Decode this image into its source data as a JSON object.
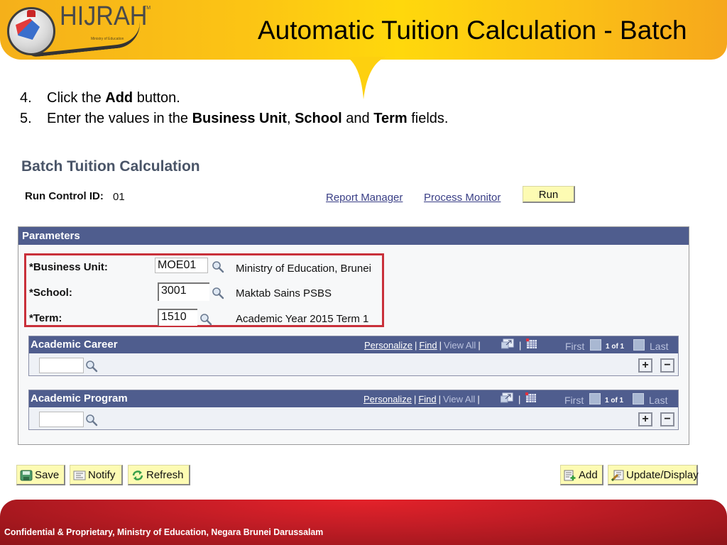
{
  "slide": {
    "logo_text": "HIJRAH",
    "logo_tm": "TM",
    "logo_subtitle": "Ministry of Education",
    "title": "Automatic Tuition Calculation - Batch",
    "footer": "Confidential & Proprietary, Ministry of Education, Negara Brunei Darussalam"
  },
  "instructions": [
    {
      "num": "4.",
      "pre": "Click the ",
      "b1": "Add",
      "mid1": " button.",
      "b2": "",
      "mid2": "",
      "b3": "",
      "post": ""
    },
    {
      "num": "5.",
      "pre": "Enter the values in the ",
      "b1": "Business Unit",
      "mid1": ", ",
      "b2": "School",
      "mid2": " and ",
      "b3": "Term",
      "post": " fields."
    }
  ],
  "page": {
    "title": "Batch Tuition Calculation",
    "run_control_label": "Run Control ID:",
    "run_control_value": "01",
    "report_manager": "Report Manager",
    "process_monitor": "Process Monitor",
    "run_button": "Run"
  },
  "parameters": {
    "header": "Parameters",
    "fields": [
      {
        "label": "*Business Unit:",
        "value": "MOE01",
        "description": "Ministry of Education, Brunei"
      },
      {
        "label": "*School:",
        "value": "3001",
        "description": "Maktab Sains PSBS"
      },
      {
        "label": "*Term:",
        "value": "1510",
        "description": "Academic Year 2015 Term 1"
      }
    ]
  },
  "grids": [
    {
      "title": "Academic Career",
      "personalize": "Personalize",
      "find": "Find",
      "view_all": "View All",
      "first": "First",
      "count": "1 of 1",
      "last": "Last",
      "value": "",
      "add": "+",
      "remove": "−"
    },
    {
      "title": "Academic Program",
      "personalize": "Personalize",
      "find": "Find",
      "view_all": "View All",
      "first": "First",
      "count": "1 of 1",
      "last": "Last",
      "value": "",
      "add": "+",
      "remove": "−"
    }
  ],
  "toolbar": {
    "save": "Save",
    "notify": "Notify",
    "refresh": "Refresh",
    "add": "Add",
    "update_display": "Update/Display"
  },
  "colors": {
    "banner": "#fcc514",
    "header_bar": "#4f5d8e",
    "highlight": "#c9303a",
    "button_bg": "#fdfbb3",
    "footer": "#c41d26"
  }
}
